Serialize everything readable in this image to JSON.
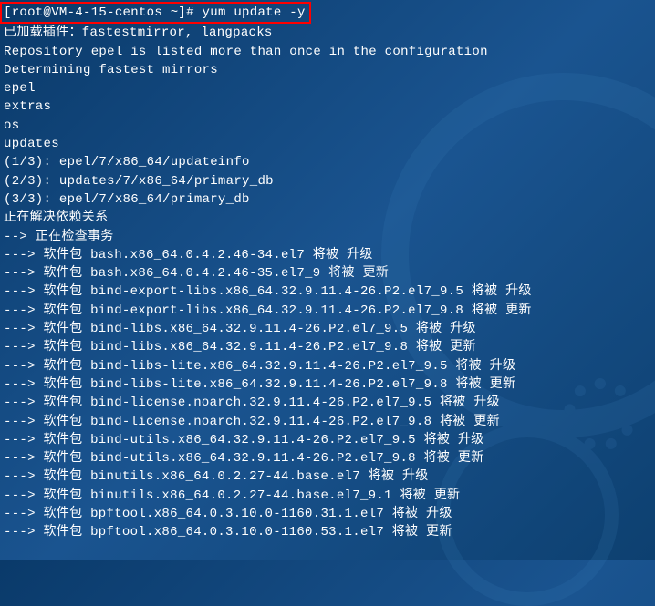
{
  "prompt": {
    "user_host": "[root@VM-4-15-centos ~]#",
    "command": " yum update -y"
  },
  "output": [
    "已加载插件：fastestmirror, langpacks",
    "Repository epel is listed more than once in the configuration",
    "Determining fastest mirrors",
    "epel",
    "extras",
    "os",
    "updates",
    "(1/3): epel/7/x86_64/updateinfo",
    "(2/3): updates/7/x86_64/primary_db",
    "(3/3): epel/7/x86_64/primary_db",
    "正在解决依赖关系",
    "--> 正在检查事务",
    "---> 软件包 bash.x86_64.0.4.2.46-34.el7 将被 升级",
    "---> 软件包 bash.x86_64.0.4.2.46-35.el7_9 将被 更新",
    "---> 软件包 bind-export-libs.x86_64.32.9.11.4-26.P2.el7_9.5 将被 升级",
    "---> 软件包 bind-export-libs.x86_64.32.9.11.4-26.P2.el7_9.8 将被 更新",
    "---> 软件包 bind-libs.x86_64.32.9.11.4-26.P2.el7_9.5 将被 升级",
    "---> 软件包 bind-libs.x86_64.32.9.11.4-26.P2.el7_9.8 将被 更新",
    "---> 软件包 bind-libs-lite.x86_64.32.9.11.4-26.P2.el7_9.5 将被 升级",
    "---> 软件包 bind-libs-lite.x86_64.32.9.11.4-26.P2.el7_9.8 将被 更新",
    "---> 软件包 bind-license.noarch.32.9.11.4-26.P2.el7_9.5 将被 升级",
    "---> 软件包 bind-license.noarch.32.9.11.4-26.P2.el7_9.8 将被 更新",
    "---> 软件包 bind-utils.x86_64.32.9.11.4-26.P2.el7_9.5 将被 升级",
    "---> 软件包 bind-utils.x86_64.32.9.11.4-26.P2.el7_9.8 将被 更新",
    "---> 软件包 binutils.x86_64.0.2.27-44.base.el7 将被 升级",
    "---> 软件包 binutils.x86_64.0.2.27-44.base.el7_9.1 将被 更新",
    "---> 软件包 bpftool.x86_64.0.3.10.0-1160.31.1.el7 将被 升级",
    "---> 软件包 bpftool.x86_64.0.3.10.0-1160.53.1.el7 将被 更新"
  ]
}
